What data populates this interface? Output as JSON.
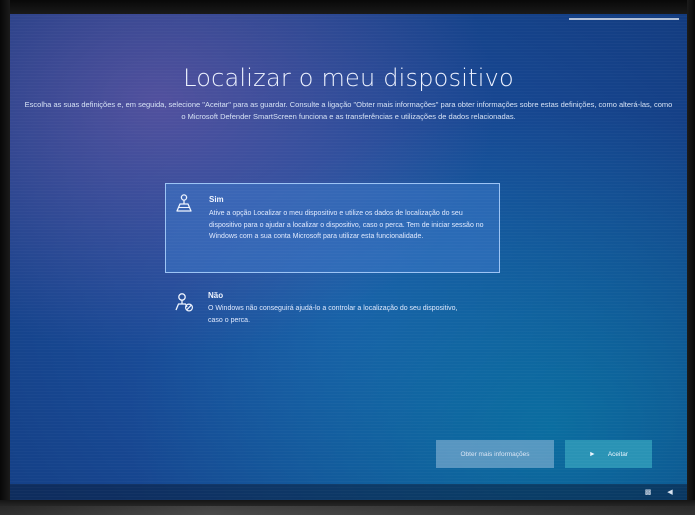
{
  "page": {
    "title": "Localizar o meu dispositivo",
    "description": "Escolha as suas definições e, em seguida, selecione \"Aceitar\" para as guardar. Consulte a ligação \"Obter mais informações\" para obter informações sobre estas definições, como alterá-las, como o Microsoft Defender SmartScreen funciona e as transferências e utilizações de dados relacionadas."
  },
  "options": [
    {
      "icon": "location-pin-person-icon",
      "title": "Sim",
      "body": "Ative a opção Localizar o meu dispositivo e utilize os dados de localização do seu dispositivo para o ajudar a localizar o dispositivo, caso o perca. Tem de iniciar sessão no Windows com a sua conta Microsoft para utilizar esta funcionalidade.",
      "selected": true
    },
    {
      "icon": "location-pin-off-icon",
      "title": "Não",
      "body": "O Windows não conseguirá ajudá-lo a controlar a localização do seu dispositivo, caso o perca.",
      "selected": false
    }
  ],
  "buttons": {
    "more_info": "Obter mais informações",
    "accept": "Aceitar"
  },
  "colors": {
    "background": "#184a96",
    "selected_option": "#3c78c8",
    "accept_button": "#2a93b5"
  }
}
